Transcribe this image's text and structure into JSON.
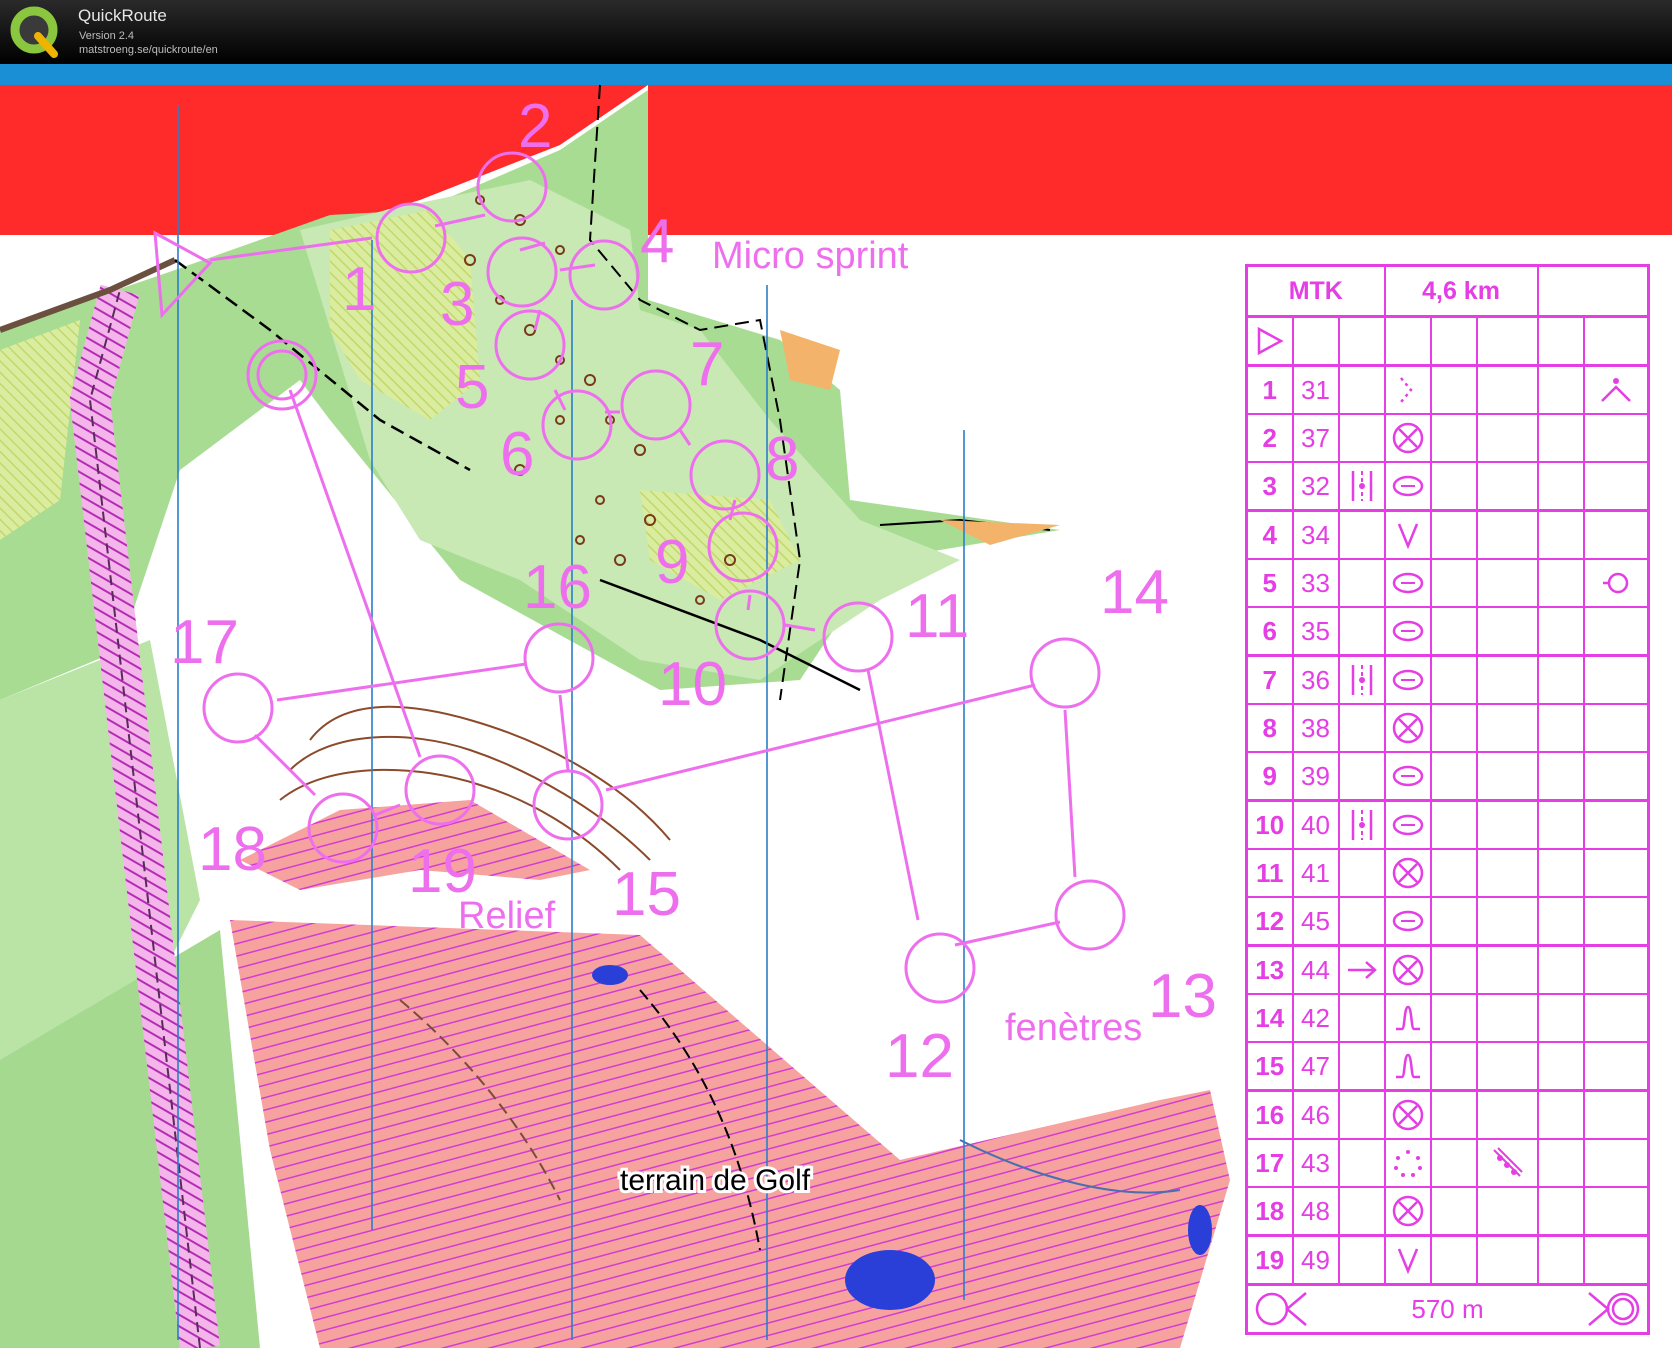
{
  "app": {
    "name": "QuickRoute",
    "version": "Version 2.4",
    "url": "matstroeng.se/quickroute/en"
  },
  "map": {
    "control_numbers": [
      "1",
      "2",
      "3",
      "4",
      "5",
      "6",
      "7",
      "8",
      "9",
      "10",
      "11",
      "12",
      "13",
      "14",
      "15",
      "16",
      "17",
      "18",
      "19"
    ],
    "labels": {
      "micro_sprint": "Micro sprint",
      "relief": "Relief",
      "fenetres": "fenètres",
      "golf": "terrain de Golf"
    }
  },
  "description_sheet": {
    "event": "MTK",
    "distance": "4,6 km",
    "rows": [
      {
        "n": "1",
        "code": "31",
        "c": "",
        "d": "spur",
        "g": "",
        "h": "top"
      },
      {
        "n": "2",
        "code": "37",
        "c": "",
        "d": "cross",
        "g": "",
        "h": ""
      },
      {
        "n": "3",
        "code": "32",
        "c": "stripes",
        "d": "boulder",
        "g": "",
        "h": ""
      },
      {
        "n": "4",
        "code": "34",
        "c": "",
        "d": "vee",
        "g": "",
        "h": ""
      },
      {
        "n": "5",
        "code": "33",
        "c": "",
        "d": "boulder",
        "g": "",
        "h": "west"
      },
      {
        "n": "6",
        "code": "35",
        "c": "",
        "d": "boulder",
        "g": "",
        "h": ""
      },
      {
        "n": "7",
        "code": "36",
        "c": "stripes",
        "d": "boulder",
        "g": "",
        "h": ""
      },
      {
        "n": "8",
        "code": "38",
        "c": "",
        "d": "cross",
        "g": "",
        "h": ""
      },
      {
        "n": "9",
        "code": "39",
        "c": "",
        "d": "boulder",
        "g": "",
        "h": ""
      },
      {
        "n": "10",
        "code": "40",
        "c": "stripes",
        "d": "boulder",
        "g": "",
        "h": ""
      },
      {
        "n": "11",
        "code": "41",
        "c": "",
        "d": "cross",
        "g": "",
        "h": ""
      },
      {
        "n": "12",
        "code": "45",
        "c": "",
        "d": "boulder",
        "g": "",
        "h": ""
      },
      {
        "n": "13",
        "code": "44",
        "c": "arrow",
        "d": "cross",
        "g": "",
        "h": ""
      },
      {
        "n": "14",
        "code": "42",
        "c": "",
        "d": "knoll",
        "g": "",
        "h": ""
      },
      {
        "n": "15",
        "code": "47",
        "c": "",
        "d": "knoll",
        "g": "",
        "h": ""
      },
      {
        "n": "16",
        "code": "46",
        "c": "",
        "d": "cross",
        "g": "",
        "h": ""
      },
      {
        "n": "17",
        "code": "43",
        "c": "",
        "d": "dots",
        "g": "rocky",
        "h": ""
      },
      {
        "n": "18",
        "code": "48",
        "c": "",
        "d": "cross",
        "g": "",
        "h": ""
      },
      {
        "n": "19",
        "code": "49",
        "c": "",
        "d": "vee",
        "g": "",
        "h": ""
      }
    ],
    "finish_distance": "570 m"
  },
  "colors": {
    "magenta": "#e43ee4",
    "course": "#ee6fee",
    "red_banner": "#ff2a2a",
    "blue_bar": "#1a8fd6",
    "forest_green": "#9fd88a",
    "golf_pink": "#f7a7a2"
  }
}
